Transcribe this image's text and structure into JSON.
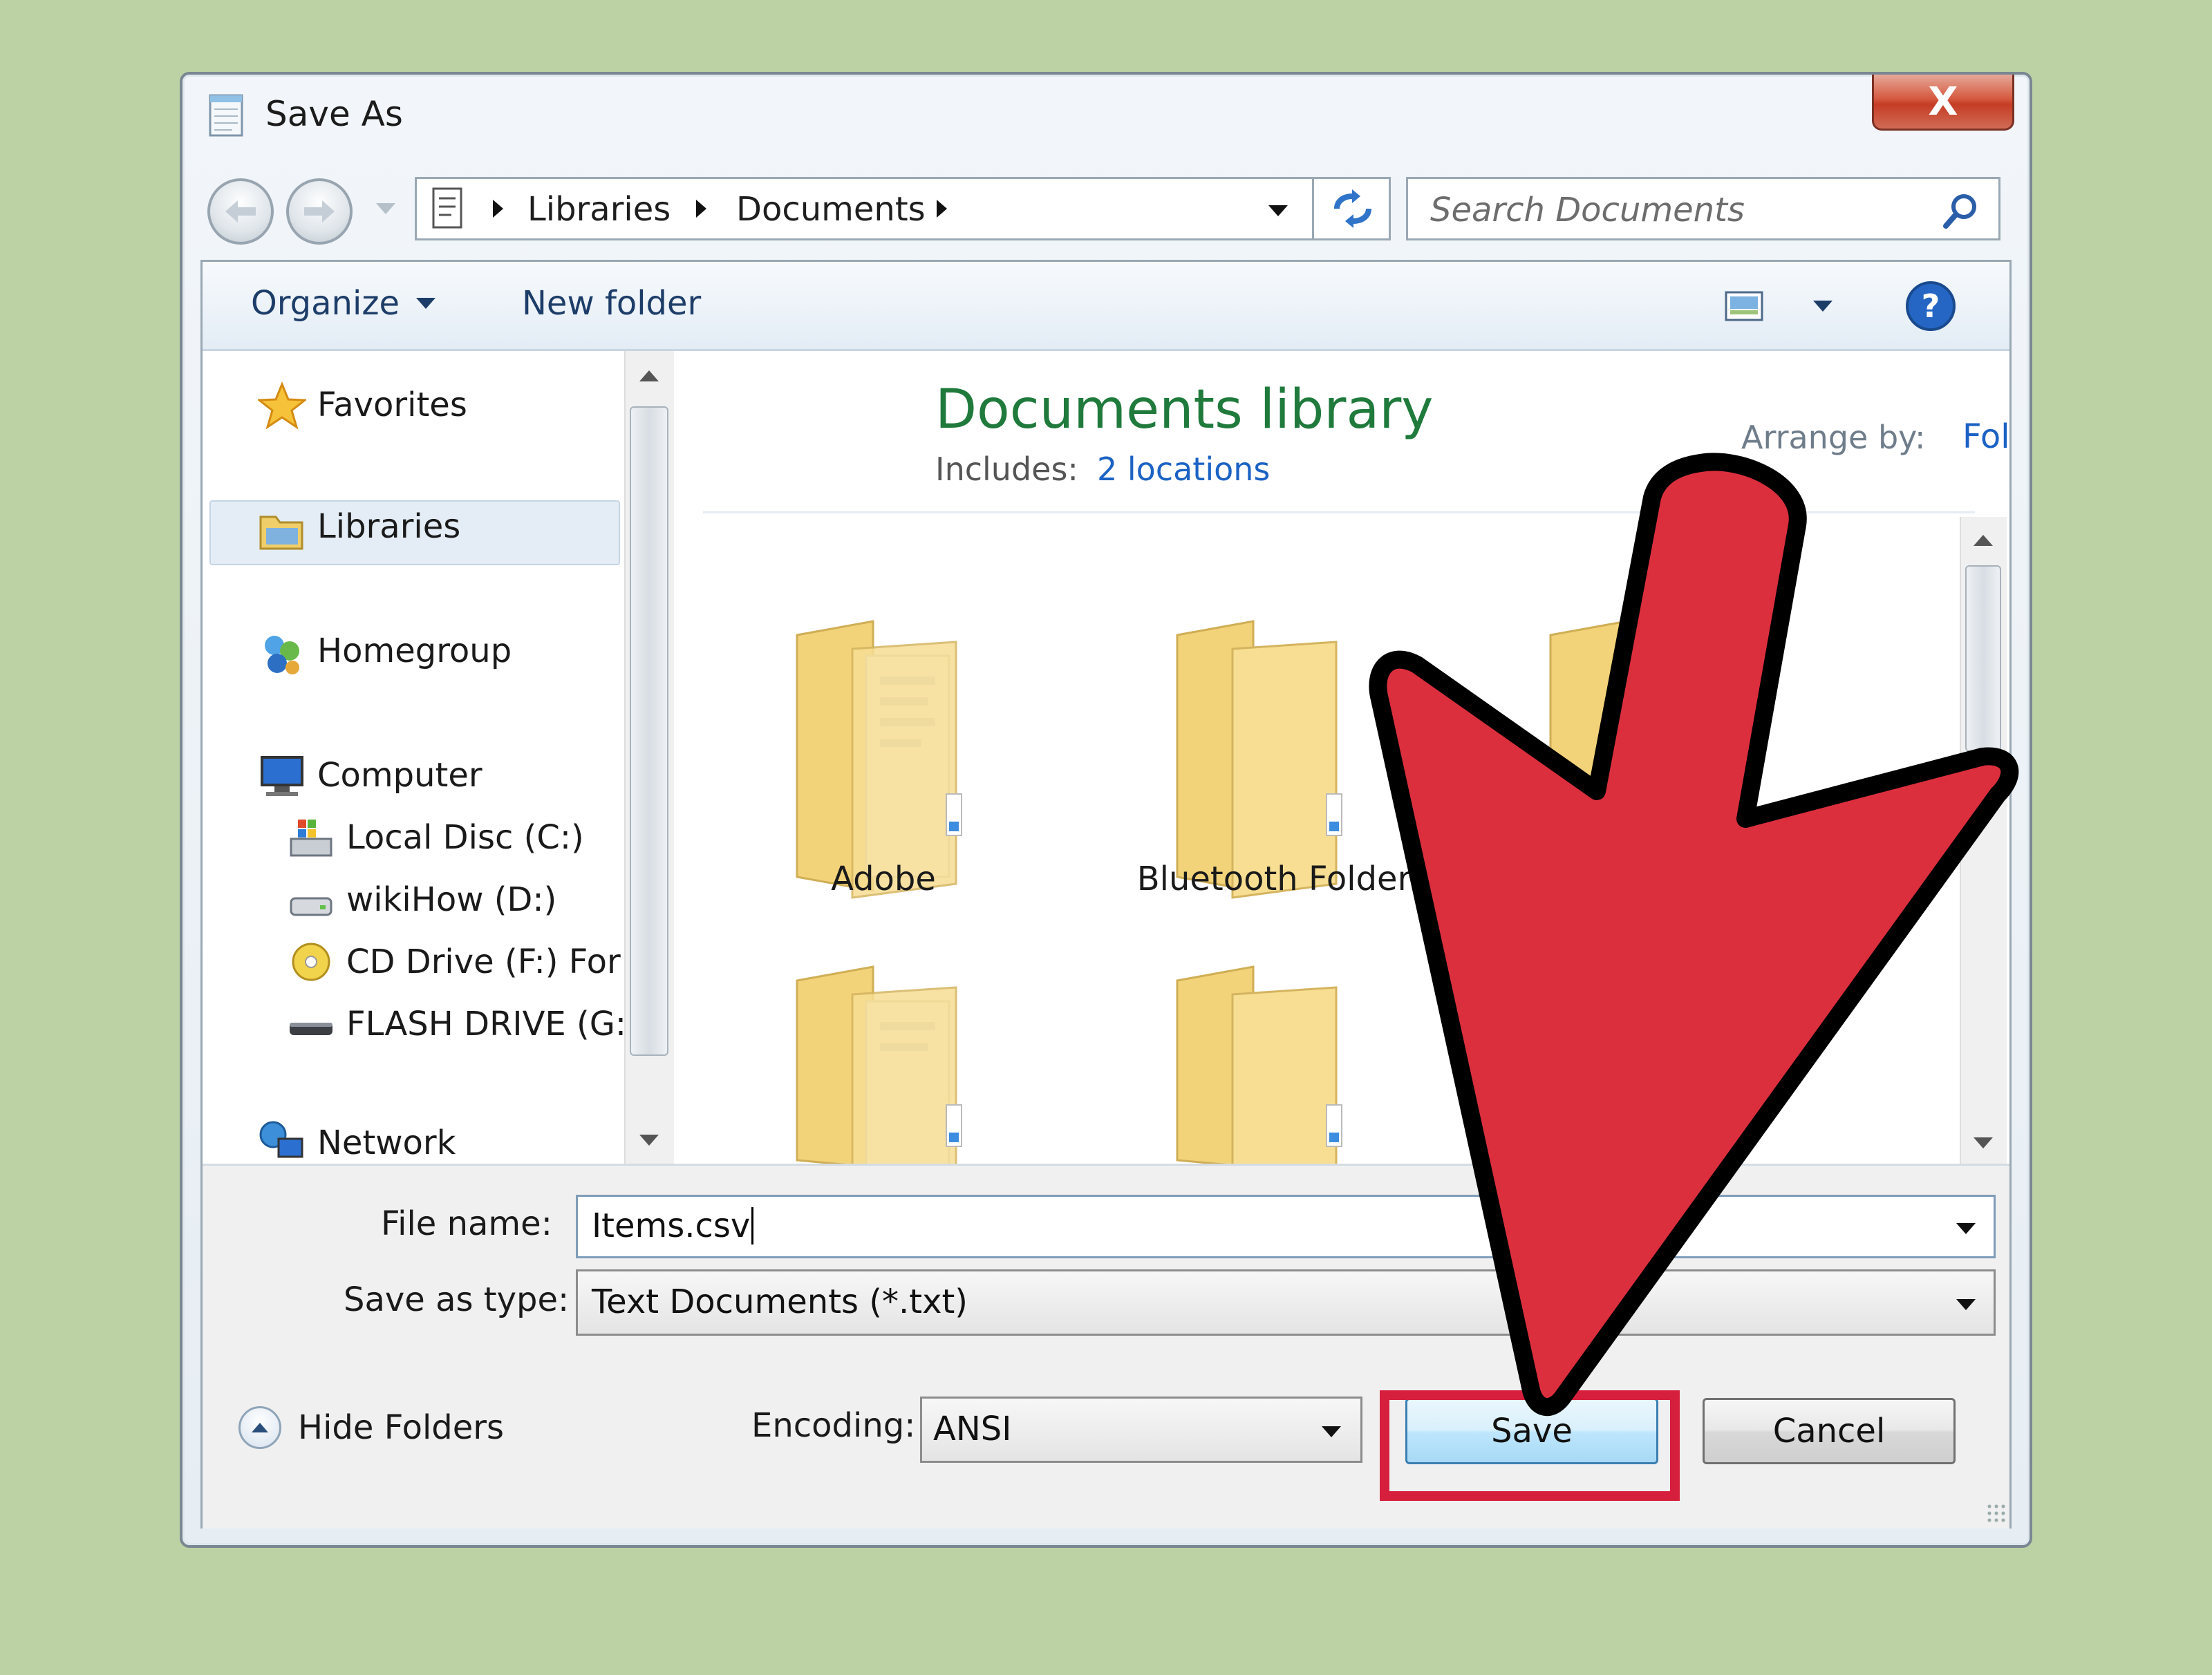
{
  "window": {
    "title": "Save As",
    "close_label": "X"
  },
  "address": {
    "crumbs": [
      "Libraries",
      "Documents"
    ]
  },
  "search": {
    "placeholder": "Search Documents"
  },
  "toolbar": {
    "organize_label": "Organize",
    "new_folder_label": "New folder"
  },
  "nav": {
    "favorites": "Favorites",
    "libraries": "Libraries",
    "homegroup": "Homegroup",
    "computer": "Computer",
    "drives": [
      "Local Disc (C:)",
      "wikiHow (D:)",
      "CD Drive (F:) For I",
      "FLASH DRIVE (G:)"
    ],
    "network": "Network"
  },
  "content": {
    "title": "Documents library",
    "includes_label": "Includes:",
    "locations_link": "2 locations",
    "arrange_label": "Arrange by:",
    "arrange_value": "Folder",
    "folders": [
      "Adobe",
      "Bluetooth Folder"
    ]
  },
  "form": {
    "file_name_label": "File name:",
    "file_name_value": "Items.csv",
    "save_type_label": "Save as type:",
    "save_type_value": "Text Documents (*.txt)",
    "encoding_label": "Encoding:",
    "encoding_value": "ANSI",
    "hide_folders_label": "Hide Folders",
    "save_label": "Save",
    "cancel_label": "Cancel"
  },
  "annotation": {
    "arrow_color": "#dc2f3e",
    "highlight_color": "#d51f3d"
  }
}
